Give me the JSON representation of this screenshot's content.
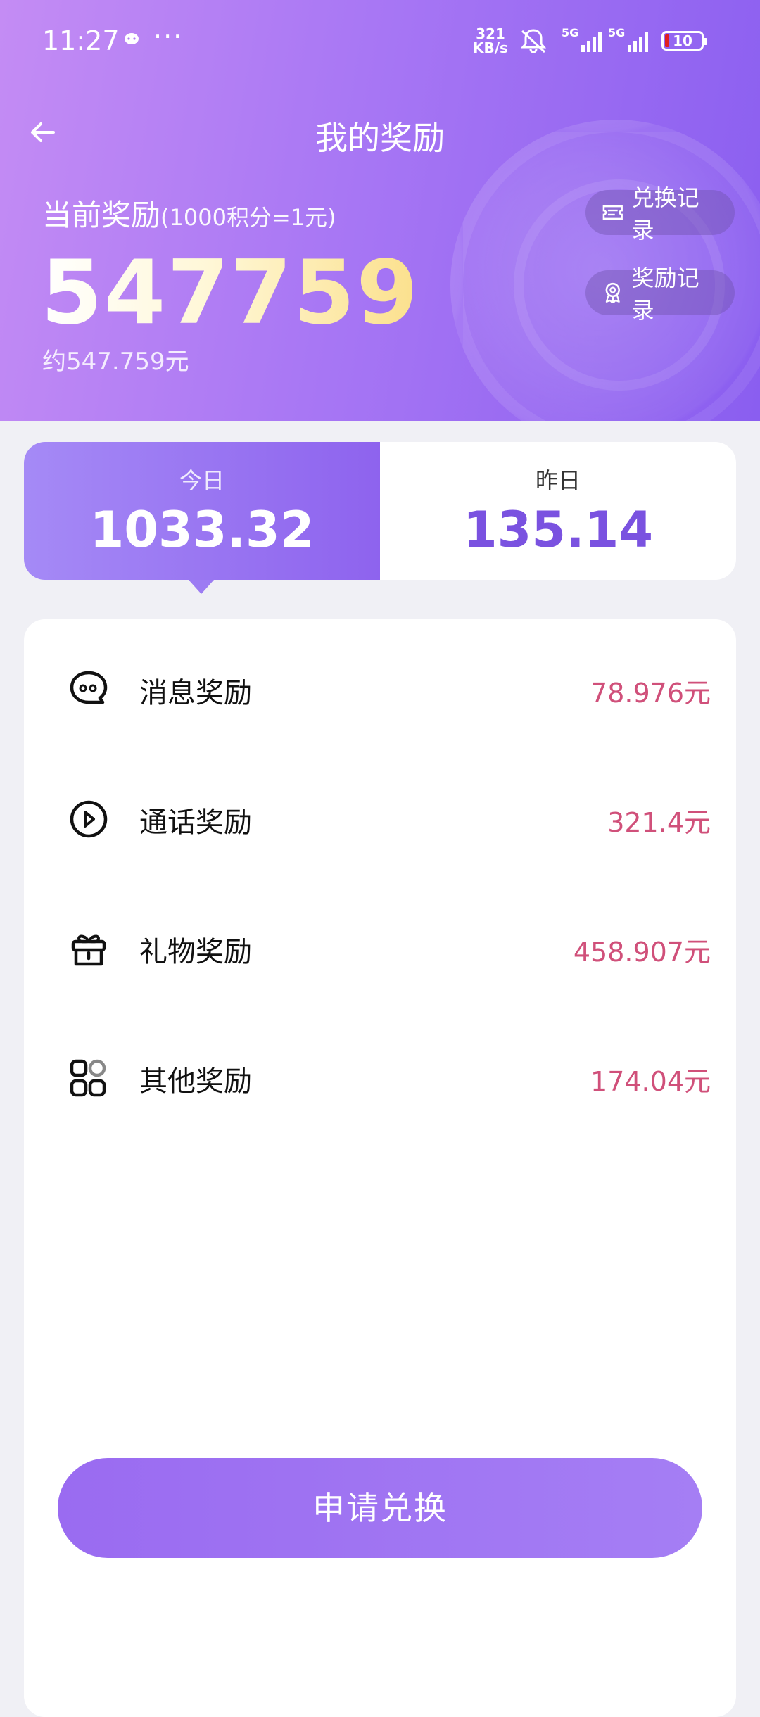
{
  "status_bar": {
    "time": "11:27",
    "message_icon": "chat-bubble-icon",
    "more": "···",
    "speed_value": "321",
    "speed_unit": "KB/s",
    "network1": "5G",
    "network2": "5G",
    "battery": "10"
  },
  "header": {
    "title": "我的奖励",
    "current_label": "当前奖励",
    "rate_note": "(1000积分=1元)",
    "points": "547759",
    "approx_value": "约547.759元",
    "exchange_record": "兑换记录",
    "reward_record": "奖励记录"
  },
  "tabs": [
    {
      "label": "今日",
      "value": "1033.32",
      "active": true
    },
    {
      "label": "昨日",
      "value": "135.14",
      "active": false
    }
  ],
  "rewards": [
    {
      "icon": "chat-bubble-icon",
      "label": "消息奖励",
      "value": "78.976元"
    },
    {
      "icon": "play-circle-icon",
      "label": "通话奖励",
      "value": "321.4元"
    },
    {
      "icon": "gift-icon",
      "label": "礼物奖励",
      "value": "458.907元"
    },
    {
      "icon": "apps-grid-icon",
      "label": "其他奖励",
      "value": "174.04元"
    }
  ],
  "apply_button": "申请兑换",
  "colors": {
    "accent": "#8e63ee",
    "reward_value": "#d0507a",
    "gold_number": "#fbe08c"
  }
}
